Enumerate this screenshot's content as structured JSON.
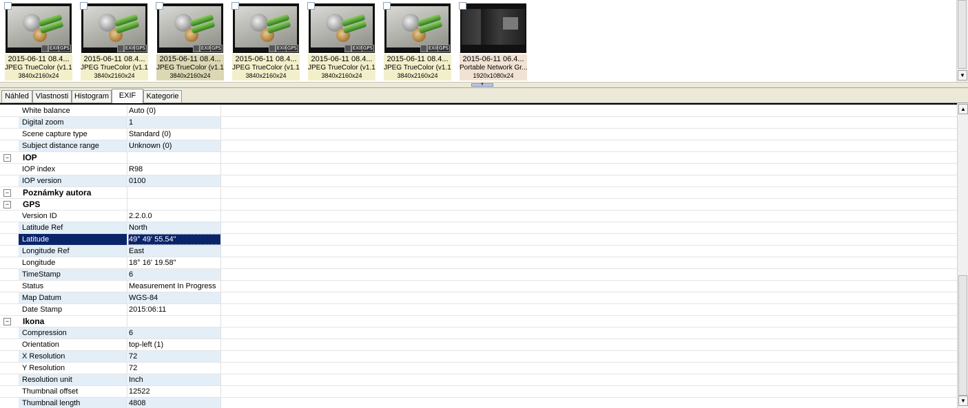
{
  "thumbnails": [
    {
      "kind": "photo",
      "date": "2015-06-11 08.4...",
      "format": "JPEG TrueColor (v1.1)",
      "size": "3840x2160x24",
      "badges": [
        "EXIF",
        "GPS"
      ],
      "selected": false
    },
    {
      "kind": "photo",
      "date": "2015-06-11 08.4...",
      "format": "JPEG TrueColor (v1.1)",
      "size": "3840x2160x24",
      "badges": [
        "EXIF",
        "GPS"
      ],
      "selected": false
    },
    {
      "kind": "photo",
      "date": "2015-06-11 08.4...",
      "format": "JPEG TrueColor (v1.1)",
      "size": "3840x2160x24",
      "badges": [
        "EXIF",
        "GPS"
      ],
      "selected": true
    },
    {
      "kind": "photo",
      "date": "2015-06-11 08.4...",
      "format": "JPEG TrueColor (v1.1)",
      "size": "3840x2160x24",
      "badges": [
        "EXIF",
        "GPS"
      ],
      "selected": false
    },
    {
      "kind": "photo",
      "date": "2015-06-11 08.4...",
      "format": "JPEG TrueColor (v1.1)",
      "size": "3840x2160x24",
      "badges": [
        "EXIF",
        "GPS"
      ],
      "selected": false
    },
    {
      "kind": "photo",
      "date": "2015-06-11 08.4...",
      "format": "JPEG TrueColor (v1.1)",
      "size": "3840x2160x24",
      "badges": [
        "EXIF",
        "GPS"
      ],
      "selected": false
    },
    {
      "kind": "screen",
      "date": "2015-06-11 06.4...",
      "format": "Portable Network Gr...",
      "size": "1920x1080x24",
      "badges": [],
      "selected": false
    }
  ],
  "tabs": [
    {
      "label": "Náhled",
      "active": false
    },
    {
      "label": "Vlastnosti",
      "active": false
    },
    {
      "label": "Histogram",
      "active": false
    },
    {
      "label": "EXIF",
      "active": true
    },
    {
      "label": "Kategorie",
      "active": false
    }
  ],
  "rows": [
    {
      "type": "prop",
      "name": "White balance",
      "value": "Auto (0)"
    },
    {
      "type": "prop",
      "name": "Digital zoom",
      "value": "1"
    },
    {
      "type": "prop",
      "name": "Scene capture type",
      "value": "Standard (0)"
    },
    {
      "type": "prop",
      "name": "Subject distance range",
      "value": "Unknown (0)"
    },
    {
      "type": "category",
      "name": "IOP",
      "expander": "−"
    },
    {
      "type": "prop",
      "name": "IOP index",
      "value": "R98"
    },
    {
      "type": "prop",
      "name": "IOP version",
      "value": "0100"
    },
    {
      "type": "category",
      "name": "Poznámky autora",
      "expander": "−"
    },
    {
      "type": "category",
      "name": "GPS",
      "expander": "−"
    },
    {
      "type": "prop",
      "name": "Version ID",
      "value": "2.2.0.0"
    },
    {
      "type": "prop",
      "name": "Latitude Ref",
      "value": "North"
    },
    {
      "type": "prop",
      "name": "Latitude",
      "value": "49° 49' 55.54\"",
      "selected": true
    },
    {
      "type": "prop",
      "name": "Longitude Ref",
      "value": "East"
    },
    {
      "type": "prop",
      "name": "Longitude",
      "value": "18° 16' 19.58\""
    },
    {
      "type": "prop",
      "name": "TimeStamp",
      "value": "6"
    },
    {
      "type": "prop",
      "name": "Status",
      "value": "Measurement In Progress"
    },
    {
      "type": "prop",
      "name": "Map Datum",
      "value": "WGS-84"
    },
    {
      "type": "prop",
      "name": "Date Stamp",
      "value": "2015:06:11"
    },
    {
      "type": "category",
      "name": "Ikona",
      "expander": "−"
    },
    {
      "type": "prop",
      "name": "Compression",
      "value": "6"
    },
    {
      "type": "prop",
      "name": "Orientation",
      "value": "top-left (1)"
    },
    {
      "type": "prop",
      "name": "X Resolution",
      "value": "72"
    },
    {
      "type": "prop",
      "name": "Y Resolution",
      "value": "72"
    },
    {
      "type": "prop",
      "name": "Resolution unit",
      "value": "Inch"
    },
    {
      "type": "prop",
      "name": "Thumbnail offset",
      "value": "12522"
    },
    {
      "type": "prop",
      "name": "Thumbnail length",
      "value": "4808"
    }
  ],
  "scrollbar": {
    "up_arrow": "▲",
    "down_arrow": "▼"
  },
  "splitter": {
    "grip_glyph": "▼"
  }
}
